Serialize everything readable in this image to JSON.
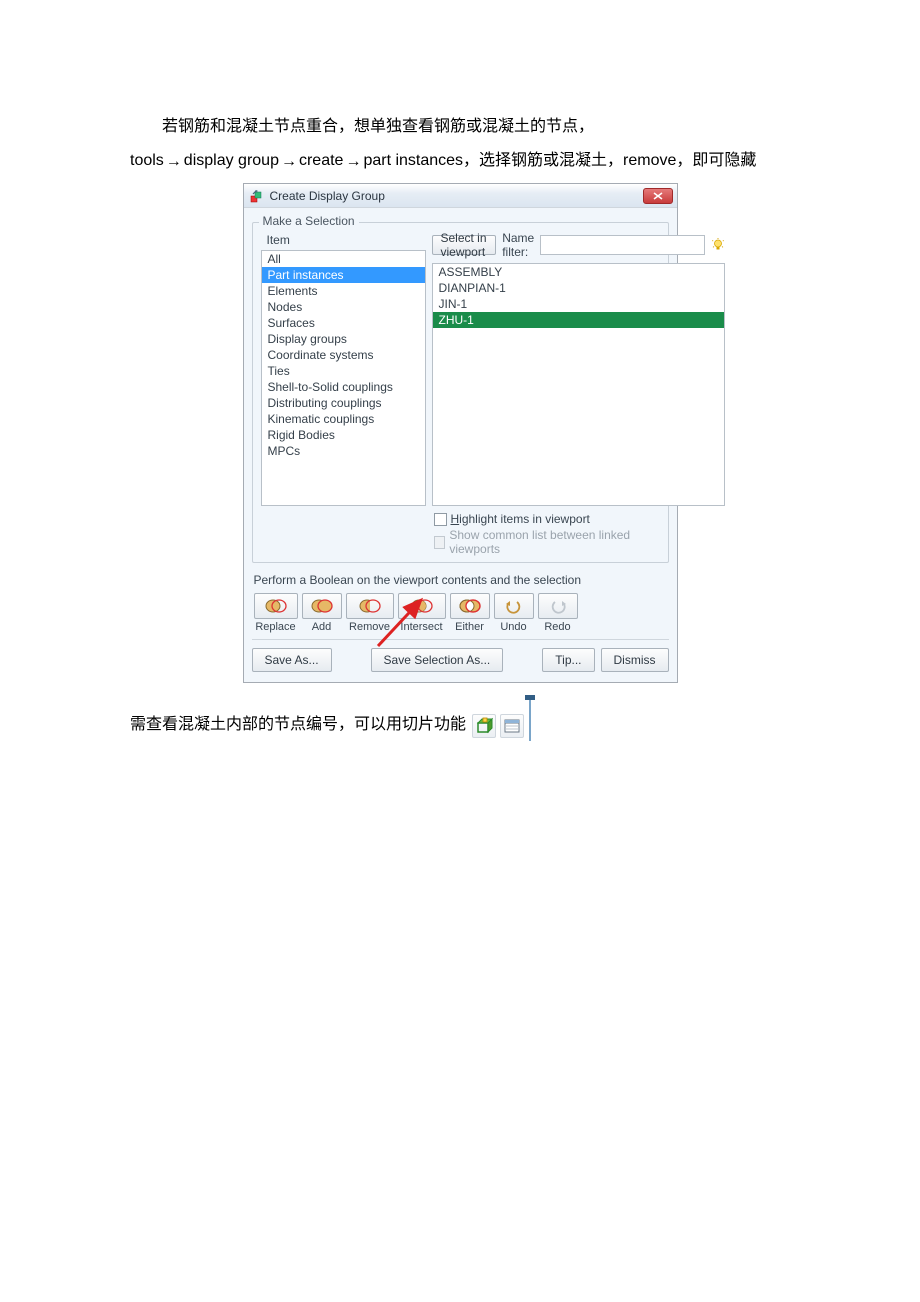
{
  "paragraph1": "若钢筋和混凝土节点重合，想单独查看钢筋或混凝土的节点，",
  "paragraph2_pre": "tools",
  "paragraph2_a": "display group",
  "paragraph2_b": "create",
  "paragraph2_c": "part instances，选择钢筋或混凝土，remove，即可隐藏",
  "dialog": {
    "title": "Create Display Group",
    "group_title": "Make a Selection",
    "item_label": "Item",
    "items": [
      "All",
      "Part instances",
      "Elements",
      "Nodes",
      "Surfaces",
      "Display groups",
      "Coordinate systems",
      "Ties",
      "Shell-to-Solid couplings",
      "Distributing couplings",
      "Kinematic couplings",
      "Rigid Bodies",
      "MPCs"
    ],
    "item_selected_index": 1,
    "select_in_viewport": "Select in viewport",
    "name_filter_label": "Name filter:",
    "right_items": [
      "ASSEMBLY",
      "DIANPIAN-1",
      "JIN-1",
      "ZHU-1"
    ],
    "right_selected_index": 3,
    "chk_highlight": "Highlight items in viewport",
    "chk_common": "Show common list between linked viewports",
    "boolean_label": "Perform a Boolean on the viewport contents and the selection",
    "ops": [
      "Replace",
      "Add",
      "Remove",
      "Intersect",
      "Either",
      "Undo",
      "Redo"
    ],
    "save_as": "Save As...",
    "save_sel_as": "Save Selection As...",
    "tip": "Tip...",
    "dismiss": "Dismiss"
  },
  "footer": "需查看混凝土内部的节点编号，可以用切片功能"
}
